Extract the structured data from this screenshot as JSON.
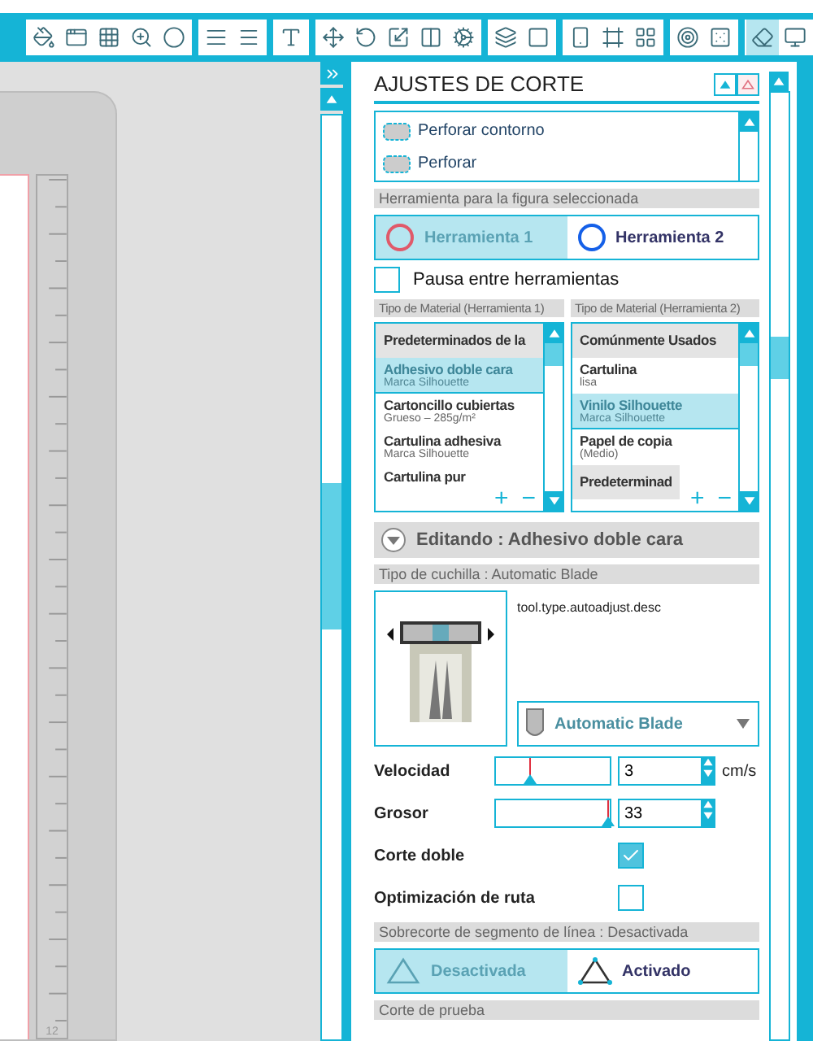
{
  "toolbar": {
    "groups": [
      [
        {
          "selected": false
        },
        {
          "selected": false
        },
        {
          "selected": false
        },
        {
          "selected": false
        },
        {
          "selected": false
        }
      ],
      [
        {
          "selected": false
        },
        {
          "selected": false
        }
      ],
      [
        {
          "selected": false
        }
      ],
      [
        {
          "selected": false
        },
        {
          "selected": false
        },
        {
          "selected": false
        },
        {
          "selected": false
        },
        {
          "selected": false
        }
      ],
      [
        {
          "selected": false
        },
        {
          "selected": false
        }
      ],
      [
        {
          "selected": false
        },
        {
          "selected": false
        },
        {
          "selected": false
        }
      ],
      [
        {
          "selected": false
        },
        {
          "selected": false
        }
      ],
      [
        {
          "selected": true
        },
        {
          "selected": false
        }
      ]
    ]
  },
  "canvas": {
    "ruler_label": "12"
  },
  "panel": {
    "title": "AJUSTES DE CORTE",
    "actions": {
      "items": [
        {
          "label": "Perforar contorno"
        },
        {
          "label": "Perforar"
        }
      ]
    },
    "tool_section": {
      "header": "Herramienta para la figura seleccionada",
      "tools": [
        {
          "label": "Herramienta 1",
          "selected": true,
          "color": "#e05a6a"
        },
        {
          "label": "Herramienta 2",
          "selected": false,
          "color": "#1560e8"
        }
      ]
    },
    "pause": {
      "label": "Pausa entre herramientas",
      "checked": false
    },
    "materials": [
      {
        "header": "Tipo de Material (Herramienta 1)",
        "add": "+",
        "remove": "−",
        "rows": [
          {
            "kind": "group",
            "title": "Predeterminados de la"
          },
          {
            "kind": "item",
            "title": "Adhesivo doble cara",
            "subtitle": "Marca Silhouette",
            "selected": true
          },
          {
            "kind": "item",
            "title": "Cartoncillo cubiertas",
            "subtitle": "Grueso – 285g/m²",
            "selected": false
          },
          {
            "kind": "item",
            "title": "Cartulina adhesiva",
            "subtitle": "Marca Silhouette",
            "selected": false
          },
          {
            "kind": "item",
            "title": "Cartulina pur",
            "selected": false
          }
        ]
      },
      {
        "header": "Tipo de Material (Herramienta 2)",
        "add": "+",
        "remove": "−",
        "rows": [
          {
            "kind": "group",
            "title": "Comúnmente Usados"
          },
          {
            "kind": "item",
            "title": "Cartulina",
            "subtitle": "lisa",
            "selected": false
          },
          {
            "kind": "item",
            "title": "Vinilo Silhouette",
            "subtitle": "Marca Silhouette",
            "selected": true
          },
          {
            "kind": "item",
            "title": "Papel de copia",
            "subtitle": "(Medio)",
            "selected": false
          },
          {
            "kind": "group",
            "title": "Predeterminad"
          }
        ]
      }
    ],
    "editing": {
      "label": "Editando : Adhesivo doble cara"
    },
    "blade": {
      "header": "Tipo de cuchilla : Automatic Blade",
      "description": "tool.type.autoadjust.desc",
      "selection": "Automatic Blade"
    },
    "settings": [
      {
        "kind": "slider",
        "label": "Velocidad",
        "level": 0.3,
        "value": "3",
        "unit": "cm/s"
      },
      {
        "kind": "slider",
        "label": "Grosor",
        "level": 0.98,
        "value": "33"
      },
      {
        "kind": "checkbox",
        "label": "Corte doble",
        "checked": true
      },
      {
        "kind": "checkbox",
        "label": "Optimización de ruta",
        "checked": false
      }
    ],
    "overcut": {
      "header": "Sobrecorte de segmento de línea : Desactivada",
      "options": [
        {
          "label": "Desactivada",
          "selected": true
        },
        {
          "label": "Activado",
          "selected": false
        }
      ]
    },
    "test_cut": {
      "header": "Corte de prueba"
    }
  }
}
